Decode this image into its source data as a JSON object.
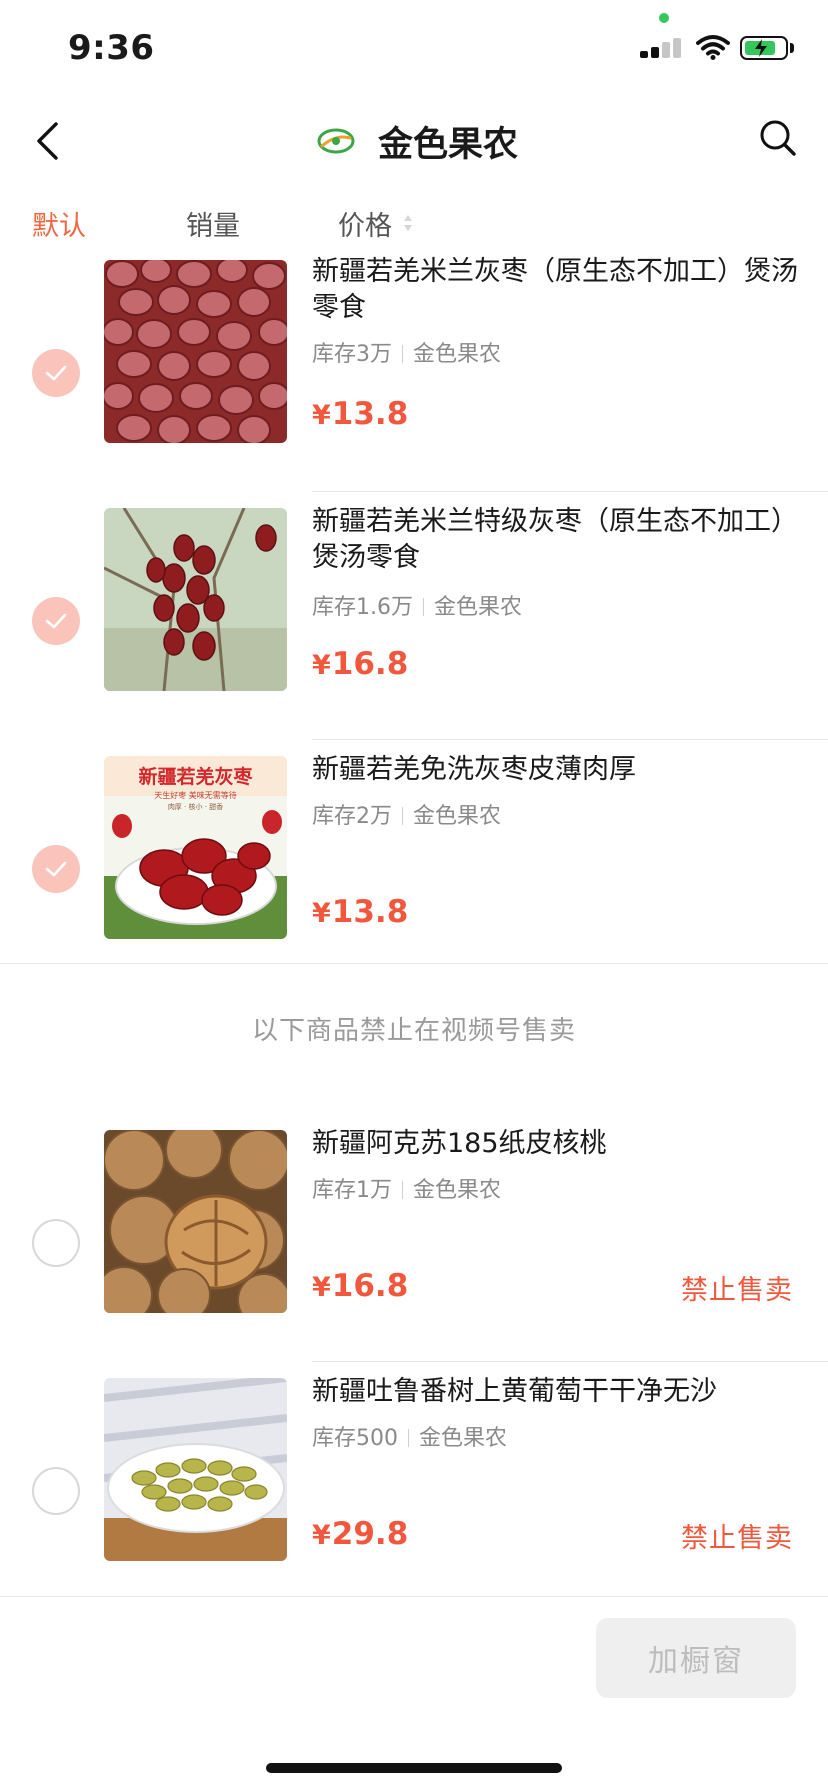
{
  "status_bar": {
    "time": "9:36"
  },
  "nav": {
    "title": "金色果农",
    "brand_logo_text": "金色果农"
  },
  "sort_tabs": [
    {
      "label": "默认",
      "active": true
    },
    {
      "label": "销量",
      "active": false
    },
    {
      "label": "价格",
      "active": false
    }
  ],
  "products": [
    {
      "title": "新疆若羌米兰灰枣（原生态不加工）煲汤零食",
      "stock": "库存3万",
      "shop": "金色果农",
      "currency": "¥",
      "price": "13.8",
      "selected": true
    },
    {
      "title": "新疆若羌米兰特级灰枣（原生态不加工）煲汤零食",
      "stock": "库存1.6万",
      "shop": "金色果农",
      "currency": "¥",
      "price": "16.8",
      "selected": true
    },
    {
      "title": "新疆若羌免洗灰枣皮薄肉厚",
      "stock": "库存2万",
      "shop": "金色果农",
      "currency": "¥",
      "price": "13.8",
      "selected": true,
      "image_text": {
        "headline": "新疆若羌灰枣",
        "tagline": "天生好枣  美味无需等待",
        "subline": "肉厚 · 核小 · 甜香"
      }
    }
  ],
  "notice": "以下商品禁止在视频号售卖",
  "banned_products": [
    {
      "title": "新疆阿克苏185纸皮核桃",
      "stock": "库存1万",
      "shop": "金色果农",
      "currency": "¥",
      "price": "16.8",
      "status": "禁止售卖",
      "selected": false
    },
    {
      "title": "新疆吐鲁番树上黄葡萄干干净无沙",
      "stock": "库存500",
      "shop": "金色果农",
      "currency": "¥",
      "price": "29.8",
      "status": "禁止售卖",
      "selected": false
    }
  ],
  "footer": {
    "add_button": "加橱窗"
  },
  "colors": {
    "accent": "#f06843",
    "price": "#f0573c",
    "check_selected": "#fbc4bb",
    "divider": "#e6e6e6"
  },
  "icons": [
    "back-arrow-icon",
    "search-icon",
    "check-icon",
    "sort-arrows-icon",
    "signal-icon",
    "wifi-icon",
    "battery-icon"
  ]
}
